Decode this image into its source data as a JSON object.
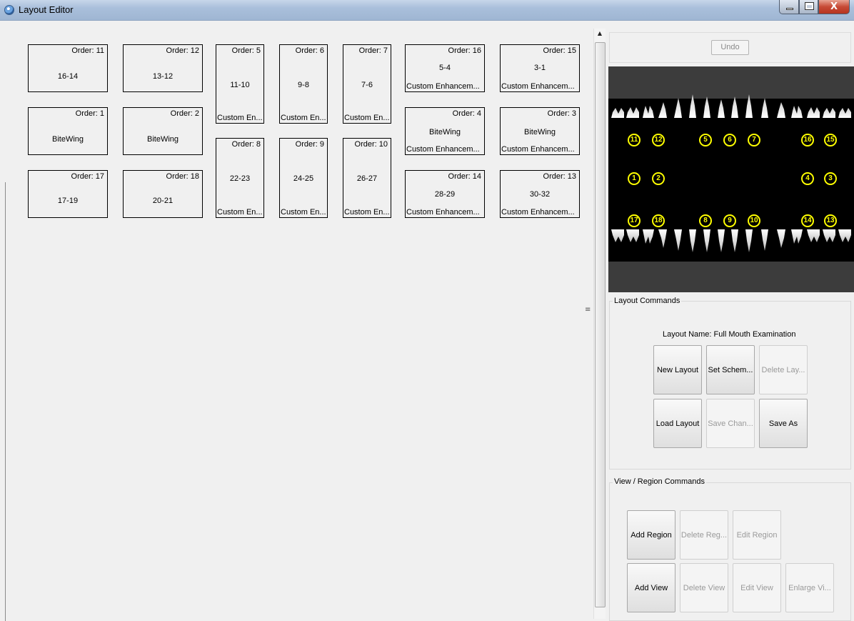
{
  "window": {
    "title": "Layout Editor",
    "close_glyph": "X"
  },
  "tiles": [
    {
      "order": "Order: 11",
      "label": "16-14",
      "custom": ""
    },
    {
      "order": "Order: 12",
      "label": "13-12",
      "custom": ""
    },
    {
      "order": "Order: 5",
      "label": "11-10",
      "custom": "Custom En..."
    },
    {
      "order": "Order: 6",
      "label": "9-8",
      "custom": "Custom En..."
    },
    {
      "order": "Order: 7",
      "label": "7-6",
      "custom": "Custom En..."
    },
    {
      "order": "Order: 16",
      "label": "5-4",
      "custom": "Custom Enhancem..."
    },
    {
      "order": "Order: 15",
      "label": "3-1",
      "custom": "Custom Enhancem..."
    },
    {
      "order": "Order: 1",
      "label": "BiteWing",
      "custom": ""
    },
    {
      "order": "Order: 2",
      "label": "BiteWing",
      "custom": ""
    },
    {
      "order": "Order: 4",
      "label": "BiteWing",
      "custom": "Custom Enhancem..."
    },
    {
      "order": "Order: 3",
      "label": "BiteWing",
      "custom": "Custom Enhancem..."
    },
    {
      "order": "Order: 8",
      "label": "22-23",
      "custom": "Custom En..."
    },
    {
      "order": "Order: 9",
      "label": "24-25",
      "custom": "Custom En..."
    },
    {
      "order": "Order: 10",
      "label": "26-27",
      "custom": "Custom En..."
    },
    {
      "order": "Order: 17",
      "label": "17-19",
      "custom": ""
    },
    {
      "order": "Order: 18",
      "label": "20-21",
      "custom": ""
    },
    {
      "order": "Order: 14",
      "label": "28-29",
      "custom": "Custom Enhancem..."
    },
    {
      "order": "Order: 13",
      "label": "30-32",
      "custom": "Custom Enhancem..."
    }
  ],
  "undo_label": "Undo",
  "xray": {
    "marker_color": "#ffff00",
    "markers": [
      "11",
      "12",
      "5",
      "6",
      "7",
      "16",
      "15",
      "1",
      "2",
      "4",
      "3",
      "17",
      "18",
      "8",
      "9",
      "10",
      "14",
      "13"
    ]
  },
  "layout_commands": {
    "title": "Layout Commands",
    "layout_name": "Layout Name: Full Mouth Examination",
    "buttons": {
      "new_layout": "New Layout",
      "set_scheme": "Set Schem...",
      "delete_layout": "Delete Lay...",
      "load_layout": "Load Layout",
      "save_changes": "Save Chan...",
      "save_as": "Save As"
    }
  },
  "region_commands": {
    "title": "View / Region Commands",
    "buttons": {
      "add_region": "Add Region",
      "delete_region": "Delete Reg...",
      "edit_region": "Edit Region",
      "add_view": "Add View",
      "delete_view": "Delete View",
      "edit_view": "Edit View",
      "enlarge_view": "Enlarge Vi..."
    }
  },
  "icons": {
    "app": "app-globe-icon",
    "minimize": "minimize-icon",
    "maximize": "maximize-icon",
    "close": "close-icon",
    "scroll_up": "scroll-up-arrow-icon",
    "splitter": "splitter-grip-icon"
  }
}
